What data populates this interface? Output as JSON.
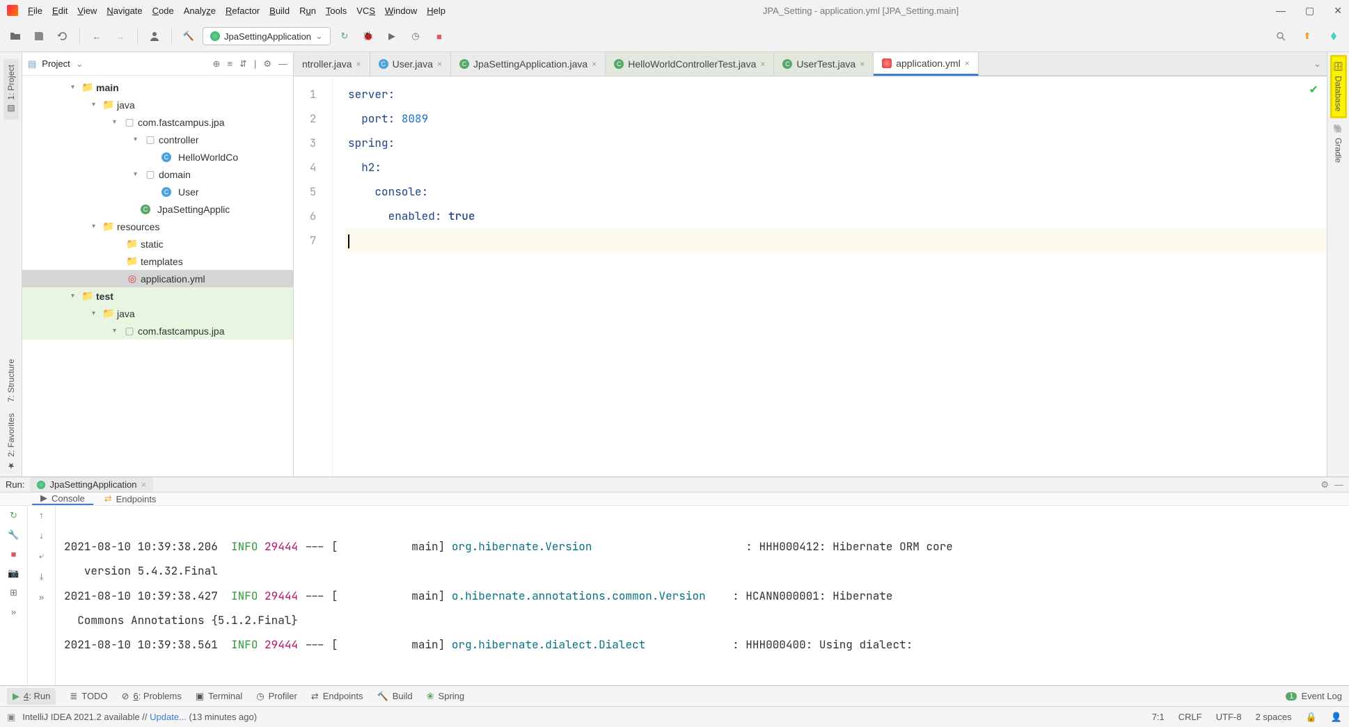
{
  "window": {
    "title": "JPA_Setting - application.yml [JPA_Setting.main]"
  },
  "menu": {
    "file": "File",
    "edit": "Edit",
    "view": "View",
    "navigate": "Navigate",
    "code": "Code",
    "analyze": "Analyze",
    "refactor": "Refactor",
    "build": "Build",
    "run": "Run",
    "tools": "Tools",
    "vcs": "VCS",
    "window": "Window",
    "help": "Help"
  },
  "toolbar": {
    "run_config": "JpaSettingApplication"
  },
  "left_tools": {
    "project": "1: Project"
  },
  "right_tools": {
    "database": "Database",
    "gradle": "Gradle"
  },
  "project": {
    "title": "Project",
    "tree": {
      "main": "main",
      "java": "java",
      "pkg": "com.fastcampus.jpa",
      "controller": "controller",
      "hello": "HelloWorldCo",
      "domain": "domain",
      "user": "User",
      "app": "JpaSettingApplic",
      "resources": "resources",
      "static": "static",
      "templates": "templates",
      "yml": "application.yml",
      "test": "test",
      "java2": "java",
      "pkg2": "com.fastcampus.jpa"
    }
  },
  "tabs": [
    {
      "label": "ntroller.java"
    },
    {
      "label": "User.java"
    },
    {
      "label": "JpaSettingApplication.java"
    },
    {
      "label": "HelloWorldControllerTest.java"
    },
    {
      "label": "UserTest.java"
    },
    {
      "label": "application.yml"
    }
  ],
  "editor": {
    "line_numbers": [
      "1",
      "2",
      "3",
      "4",
      "5",
      "6",
      "7"
    ],
    "lines": {
      "l1_key": "server",
      "l2_key": "port",
      "l2_val": "8089",
      "l3_key": "spring",
      "l4_key": "h2",
      "l5_key": "console",
      "l6_key": "enabled",
      "l6_val": "true"
    }
  },
  "run": {
    "label": "Run:",
    "config": "JpaSettingApplication",
    "console_tab": "Console",
    "endpoints_tab": "Endpoints",
    "log": [
      {
        "ts": "2021-08-10 10:39:38.206",
        "level": "INFO",
        "pid": "29444",
        "thread": "--- [           main]",
        "class": "org.hibernate.Version",
        "msg": ": HHH000412: Hibernate ORM core"
      },
      {
        "cont": "   version 5.4.32.Final"
      },
      {
        "ts": "2021-08-10 10:39:38.427",
        "level": "INFO",
        "pid": "29444",
        "thread": "--- [           main]",
        "class": "o.hibernate.annotations.common.Version",
        "msg": ": HCANN000001: Hibernate"
      },
      {
        "cont": "  Commons Annotations {5.1.2.Final}"
      },
      {
        "ts": "2021-08-10 10:39:38.561",
        "level": "INFO",
        "pid": "29444",
        "thread": "--- [           main]",
        "class": "org.hibernate.dialect.Dialect",
        "msg": ": HHH000400: Using dialect:"
      }
    ]
  },
  "bottom": {
    "run": "4: Run",
    "todo": "TODO",
    "problems": "6: Problems",
    "terminal": "Terminal",
    "profiler": "Profiler",
    "endpoints": "Endpoints",
    "build": "Build",
    "spring": "Spring",
    "event_log": "Event Log"
  },
  "status": {
    "msg_pre": "IntelliJ IDEA 2021.2 available // ",
    "msg_link": "Update...",
    "msg_post": " (13 minutes ago)",
    "pos": "7:1",
    "crlf": "CRLF",
    "enc": "UTF-8",
    "indent": "2 spaces"
  },
  "left_tools2": {
    "structure": "7: Structure",
    "favorites": "2: Favorites"
  }
}
